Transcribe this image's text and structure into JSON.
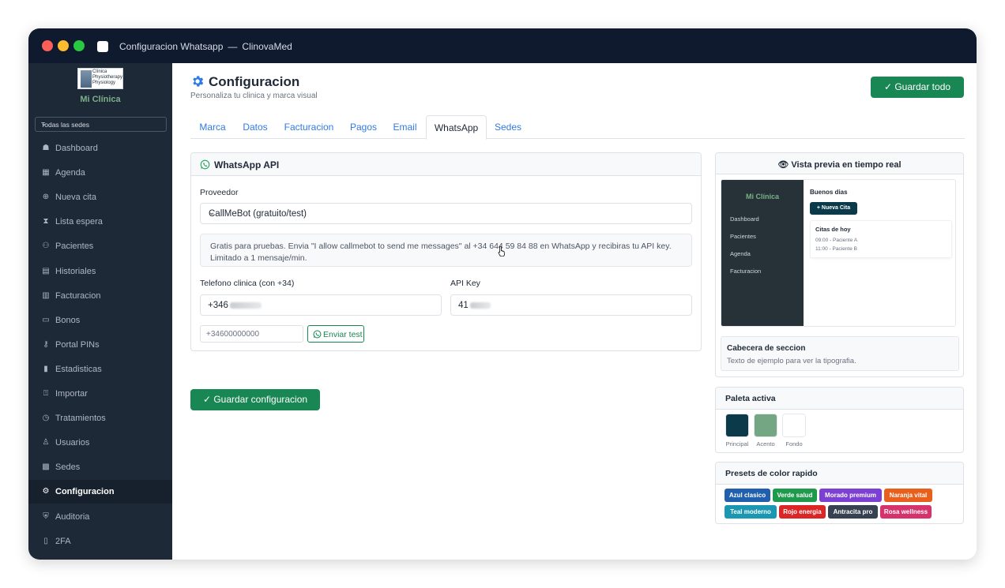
{
  "window": {
    "title": "Configuracion Whatsapp",
    "separator": "—",
    "app_name": "ClinovaMed"
  },
  "sidebar": {
    "logo_text": "Clínica Physiotherapy Physiology",
    "brand_name": "Mi Clínica",
    "sede_select": "Todas las sedes",
    "items": [
      {
        "label": "Dashboard",
        "icon": "house-icon"
      },
      {
        "label": "Agenda",
        "icon": "calendar-icon"
      },
      {
        "label": "Nueva cita",
        "icon": "plus-circle-icon"
      },
      {
        "label": "Lista espera",
        "icon": "hourglass-icon"
      },
      {
        "label": "Pacientes",
        "icon": "people-icon"
      },
      {
        "label": "Historiales",
        "icon": "file-medical-icon"
      },
      {
        "label": "Facturacion",
        "icon": "receipt-icon"
      },
      {
        "label": "Bonos",
        "icon": "ticket-icon"
      },
      {
        "label": "Portal PINs",
        "icon": "key-icon"
      },
      {
        "label": "Estadisticas",
        "icon": "bar-chart-icon"
      },
      {
        "label": "Importar",
        "icon": "file-import-icon"
      },
      {
        "label": "Tratamientos",
        "icon": "clock-icon"
      },
      {
        "label": "Usuarios",
        "icon": "person-gear-icon"
      },
      {
        "label": "Sedes",
        "icon": "building-icon"
      },
      {
        "label": "Configuracion",
        "icon": "gear-icon",
        "active": true
      },
      {
        "label": "Auditoria",
        "icon": "shield-icon"
      },
      {
        "label": "2FA",
        "icon": "phone-lock-icon"
      }
    ]
  },
  "header": {
    "title": "Configuracion",
    "subtitle": "Personaliza tu clinica y marca visual",
    "save_all": "✓ Guardar todo"
  },
  "tabs": [
    "Marca",
    "Datos",
    "Facturacion",
    "Pagos",
    "Email",
    "WhatsApp",
    "Sedes"
  ],
  "active_tab": "WhatsApp",
  "whatsapp": {
    "title": "WhatsApp API",
    "provider_label": "Proveedor",
    "provider_value": "CallMeBot (gratuito/test)",
    "info": "Gratis para pruebas. Envia \"I allow callmebot to send me messages\" al +34 644 59 84 88 en WhatsApp y recibiras tu API key. Limitado a 1 mensaje/min.",
    "phone_label": "Telefono clinica (con +34)",
    "phone_value": "+346",
    "apikey_label": "API Key",
    "apikey_value": "41",
    "test_placeholder": "+34600000000",
    "test_button": "Enviar test",
    "save_button": "✓ Guardar configuracion"
  },
  "preview": {
    "title": "Vista previa en tiempo real",
    "brand": "Mi Clínica",
    "nav": [
      "Dashboard",
      "Pacientes",
      "Agenda",
      "Facturacion"
    ],
    "greeting": "Buenos dias",
    "new_button": "+ Nueva Cita",
    "card_title": "Citas de hoy",
    "rows": [
      "09:00 - Paciente A",
      "11:00 - Paciente B"
    ],
    "section_title": "Cabecera de seccion",
    "section_text": "Texto de ejemplo para ver la tipografia."
  },
  "palette": {
    "title": "Paleta activa",
    "swatches": [
      {
        "label": "Principal",
        "color": "#0b3b4a"
      },
      {
        "label": "Acento",
        "color": "#74a683"
      },
      {
        "label": "Fondo",
        "color": "#ffffff"
      }
    ]
  },
  "presets": {
    "title": "Presets de color rapido",
    "items": [
      {
        "label": "Azul clasico",
        "color": "#1f5fad"
      },
      {
        "label": "Verde salud",
        "color": "#1f9a4d"
      },
      {
        "label": "Morado premium",
        "color": "#7b3fd1"
      },
      {
        "label": "Naranja vital",
        "color": "#e8601c"
      },
      {
        "label": "Teal moderno",
        "color": "#1a97b2"
      },
      {
        "label": "Rojo energia",
        "color": "#dc2626"
      },
      {
        "label": "Antracita pro",
        "color": "#374151"
      },
      {
        "label": "Rosa wellness",
        "color": "#d6336c"
      }
    ]
  }
}
